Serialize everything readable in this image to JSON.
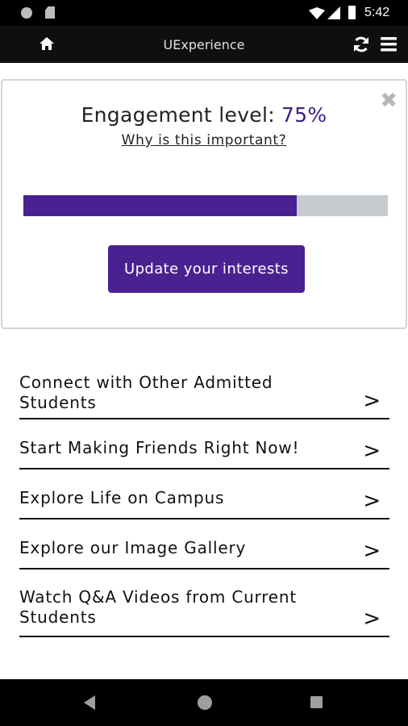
{
  "status_bar": {
    "time": "5:42"
  },
  "app_bar": {
    "title": "UExperience"
  },
  "engagement": {
    "label": "Engagement level:",
    "percent_text": "75%",
    "progress": 0.75,
    "why_link": "Why is this important?",
    "close_glyph": "✖",
    "update_button": "Update your interests"
  },
  "list": {
    "items": [
      {
        "label": "Connect with Other Admitted Students",
        "chevron": ">"
      },
      {
        "label": "Start Making Friends Right Now!",
        "chevron": ">"
      },
      {
        "label": "Explore Life on Campus",
        "chevron": ">"
      },
      {
        "label": "Explore our Image Gallery",
        "chevron": ">"
      },
      {
        "label": "Watch Q&A Videos from Current Students",
        "chevron": ">"
      }
    ]
  },
  "colors": {
    "accent": "#4a2191",
    "percent_text": "#3d1e86",
    "progress_track": "#c7cbd0"
  },
  "icons": {
    "home": "home-icon",
    "refresh": "refresh-icon",
    "menu": "hamburger-menu-icon",
    "close": "close-icon"
  }
}
